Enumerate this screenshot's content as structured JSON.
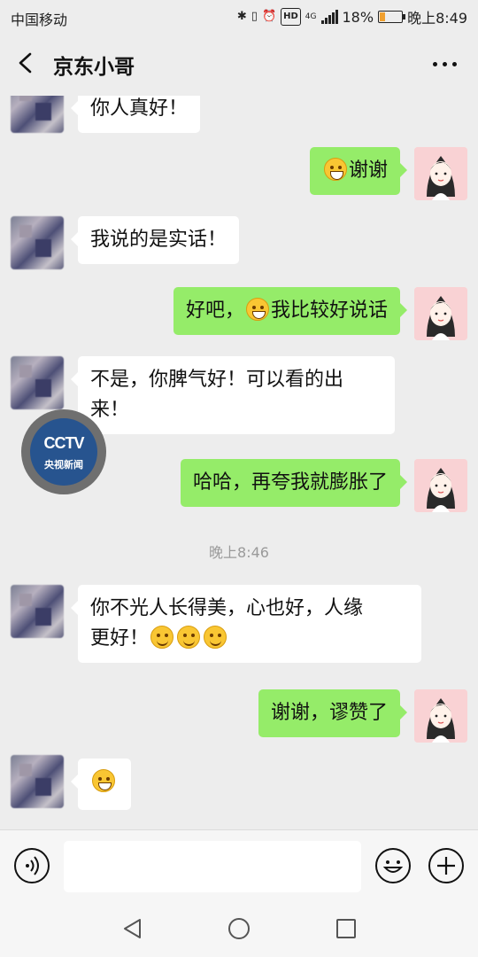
{
  "status_bar": {
    "carrier": "中国移动",
    "network": "4G",
    "hd_label": "HD",
    "battery": "18%",
    "time": "晚上8:49"
  },
  "header": {
    "title": "京东小哥",
    "back_icon": "chevron-left-icon",
    "more_icon": "more-dots-icon"
  },
  "messages": [
    {
      "side": "left",
      "text": "你人真好！"
    },
    {
      "side": "right",
      "text": "谢谢",
      "emoji_before": "laugh-cry-emoji"
    },
    {
      "side": "left",
      "text": "我说的是实话！"
    },
    {
      "side": "right",
      "text_a": "好吧，",
      "emoji_mid": "grin-emoji",
      "text_b": "我比较好说话"
    },
    {
      "side": "left",
      "line1": "不是，你脾气好！可以看的出",
      "line2": "来！"
    },
    {
      "side": "right",
      "text": "哈哈，再夸我就膨胀了"
    },
    {
      "side": "left",
      "line1": "你不光人长得美，心也好，人缘",
      "line2": "更好！",
      "emoji_after": [
        "smile-emoji",
        "smile-emoji",
        "smile-emoji"
      ]
    },
    {
      "side": "right",
      "text": "谢谢，谬赞了"
    },
    {
      "side": "left",
      "emoji_only": "big-grin-emoji"
    }
  ],
  "time_divider": "晚上8:46",
  "floating_badge": {
    "logo": "CCTV",
    "subtitle": "央视新闻"
  },
  "input_bar": {
    "voice_icon": "voice-icon",
    "emoji_icon": "emoji-icon",
    "plus_icon": "plus-icon",
    "value": ""
  },
  "system_nav": {
    "back": "triangle-back-icon",
    "home": "circle-home-icon",
    "recent": "square-recent-icon"
  }
}
